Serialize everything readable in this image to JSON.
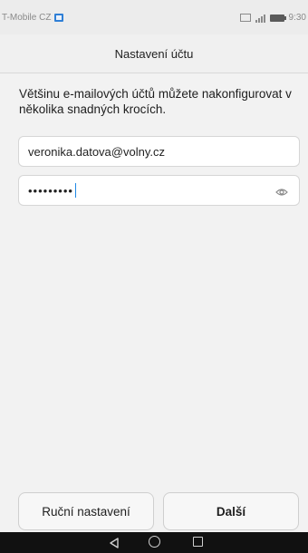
{
  "status_bar": {
    "carrier": "T-Mobile CZ",
    "time": "9:30"
  },
  "app_bar": {
    "title": "Nastavení účtu"
  },
  "intro_text": "Většinu e-mailových účtů můžete nakonfigurovat v několika snadných krocích.",
  "form": {
    "email_value": "veronika.datova@volny.cz",
    "password_masked": "•••••••••"
  },
  "buttons": {
    "manual_label": "Ruční nastavení",
    "next_label": "Další"
  },
  "icons": {
    "sim": "sim-card-icon",
    "gallery": "image-icon",
    "signal": "signal-icon",
    "battery": "battery-icon",
    "eye": "eye-icon",
    "back": "back-icon",
    "home": "home-icon",
    "recent": "recent-apps-icon"
  },
  "colors": {
    "accent": "#1e88e5",
    "nav_bar": "#111111"
  }
}
